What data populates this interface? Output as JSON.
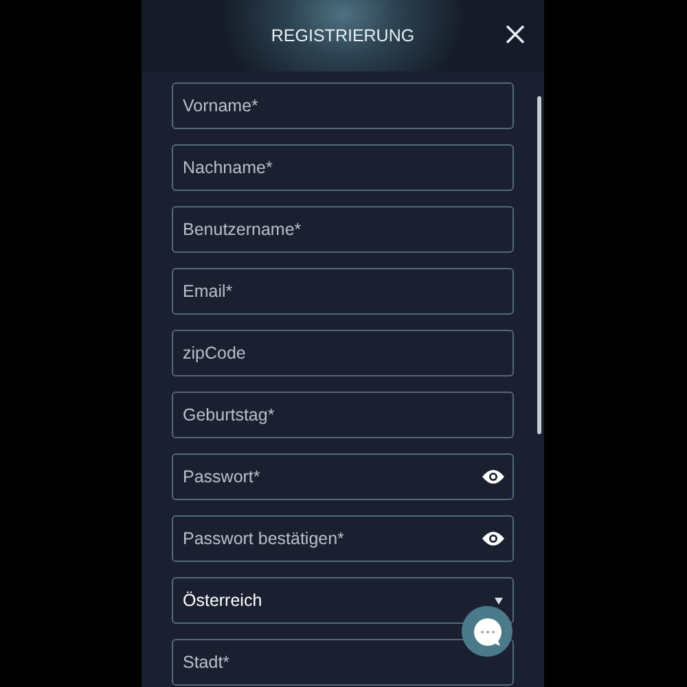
{
  "header": {
    "title": "REGISTRIERUNG"
  },
  "fields": [
    {
      "kind": "text",
      "placeholder": "Vorname*"
    },
    {
      "kind": "text",
      "placeholder": "Nachname*"
    },
    {
      "kind": "text",
      "placeholder": "Benutzername*"
    },
    {
      "kind": "text",
      "placeholder": "Email*"
    },
    {
      "kind": "text",
      "placeholder": "zipCode"
    },
    {
      "kind": "text",
      "placeholder": "Geburtstag*"
    },
    {
      "kind": "password",
      "placeholder": "Passwort*"
    },
    {
      "kind": "password",
      "placeholder": "Passwort bestätigen*"
    },
    {
      "kind": "select",
      "value": "Österreich"
    },
    {
      "kind": "text",
      "placeholder": "Stadt*"
    }
  ]
}
